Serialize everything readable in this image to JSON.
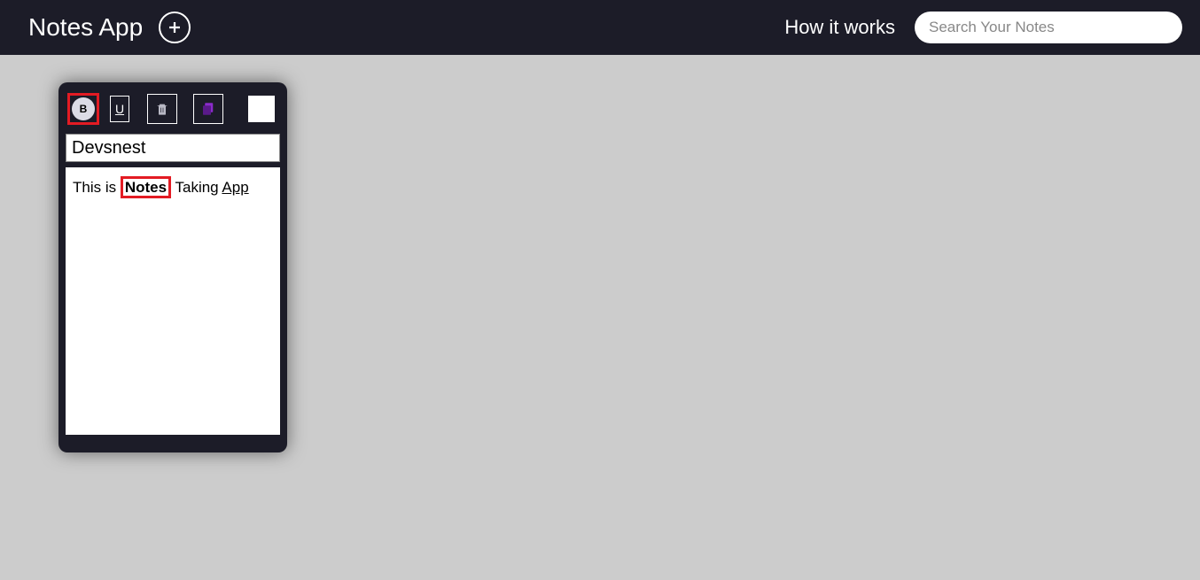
{
  "header": {
    "title": "Notes App",
    "howItWorks": "How it works",
    "searchPlaceholder": "Search Your Notes"
  },
  "note": {
    "title": "Devsnest",
    "bodyPrefix": "This is ",
    "bodyBold": "Notes",
    "bodyMiddle": " Taking ",
    "bodyUnderline": "App"
  },
  "toolbar": {
    "boldLabel": "B",
    "underlineLabel": "U"
  }
}
